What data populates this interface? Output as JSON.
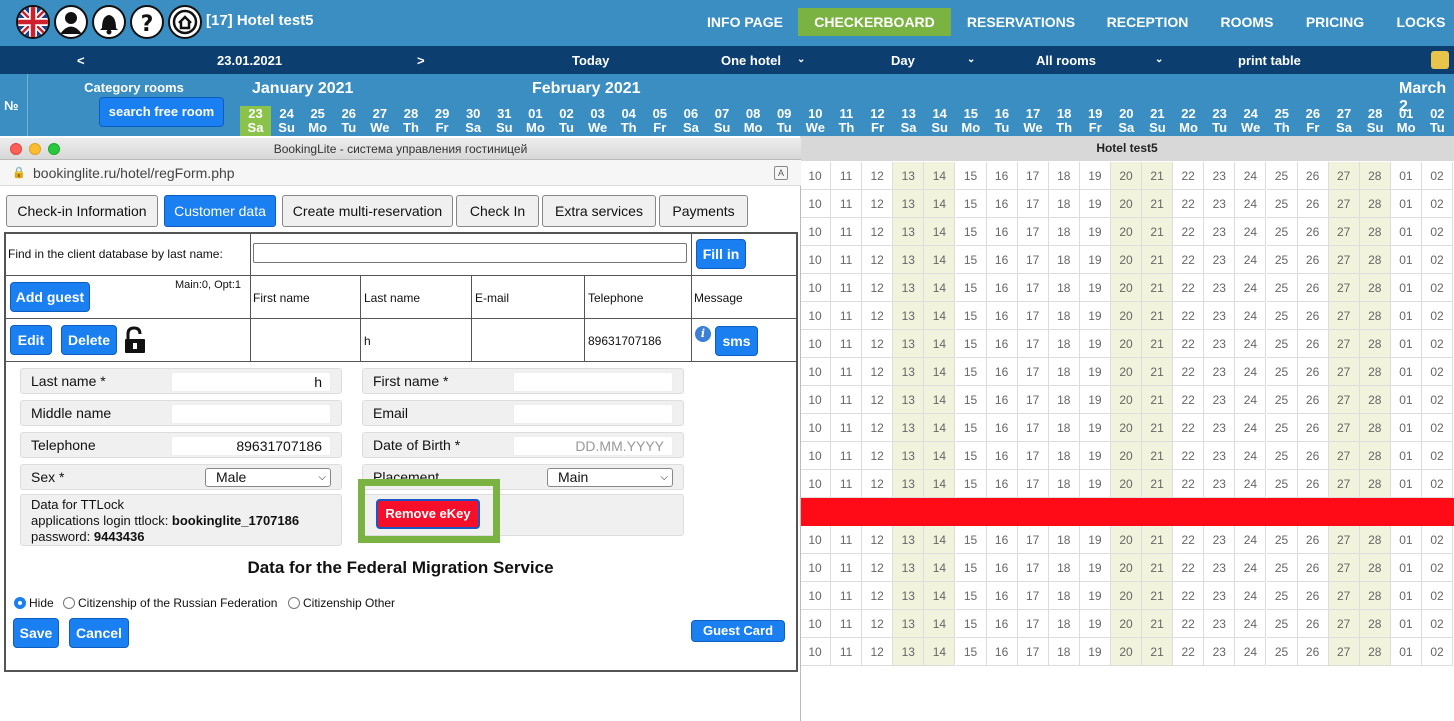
{
  "topbar": {
    "hotel_title": "[17] Hotel test5",
    "nav": [
      "INFO PAGE",
      "CHECKERBOARD",
      "RESERVATIONS",
      "RECEPTION",
      "ROOMS",
      "PRICING",
      "LOCKS"
    ],
    "active_nav": "CHECKERBOARD",
    "icons": [
      "uk-flag-icon",
      "user-icon",
      "bell-icon",
      "help-icon",
      "home-icon"
    ]
  },
  "datebar": {
    "prev": "<",
    "date": "23.01.2021",
    "next": ">",
    "today": "Today",
    "hotel_select": "One hotel",
    "view_select": "Day",
    "rooms_select": "All rooms",
    "print": "print table"
  },
  "calendar": {
    "num_label": "№",
    "category_label": "Category rooms",
    "search_free": "search free room",
    "months": [
      "January 2021",
      "February 2021",
      "March 2"
    ],
    "days": [
      [
        "23",
        "Sa"
      ],
      [
        "24",
        "Su"
      ],
      [
        "25",
        "Mo"
      ],
      [
        "26",
        "Tu"
      ],
      [
        "27",
        "We"
      ],
      [
        "28",
        "Th"
      ],
      [
        "29",
        "Fr"
      ],
      [
        "30",
        "Sa"
      ],
      [
        "31",
        "Su"
      ],
      [
        "01",
        "Mo"
      ],
      [
        "02",
        "Tu"
      ],
      [
        "03",
        "We"
      ],
      [
        "04",
        "Th"
      ],
      [
        "05",
        "Fr"
      ],
      [
        "06",
        "Sa"
      ],
      [
        "07",
        "Su"
      ],
      [
        "08",
        "Mo"
      ],
      [
        "09",
        "Tu"
      ],
      [
        "10",
        "We"
      ],
      [
        "11",
        "Th"
      ],
      [
        "12",
        "Fr"
      ],
      [
        "13",
        "Sa"
      ],
      [
        "14",
        "Su"
      ],
      [
        "15",
        "Mo"
      ],
      [
        "16",
        "Tu"
      ],
      [
        "17",
        "We"
      ],
      [
        "18",
        "Th"
      ],
      [
        "19",
        "Fr"
      ],
      [
        "20",
        "Sa"
      ],
      [
        "21",
        "Su"
      ],
      [
        "22",
        "Mo"
      ],
      [
        "23",
        "Tu"
      ],
      [
        "24",
        "We"
      ],
      [
        "25",
        "Th"
      ],
      [
        "26",
        "Fr"
      ],
      [
        "27",
        "Sa"
      ],
      [
        "28",
        "Su"
      ],
      [
        "01",
        "Mo"
      ],
      [
        "02",
        "Tu"
      ]
    ],
    "hotel_row": "Hotel test5",
    "grid_days": [
      "10",
      "11",
      "12",
      "13",
      "14",
      "15",
      "16",
      "17",
      "18",
      "19",
      "20",
      "21",
      "22",
      "23",
      "24",
      "25",
      "26",
      "27",
      "28",
      "01",
      "02"
    ],
    "weekend_days": [
      "13",
      "14",
      "20",
      "21",
      "27",
      "28"
    ]
  },
  "popup": {
    "window_title": "BookingLite - система управления гостиницей",
    "url": "bookinglite.ru/hotel/regForm.php",
    "tabs": [
      "Check-in Information",
      "Customer data",
      "Create multi-reservation",
      "Check In",
      "Extra services",
      "Payments"
    ],
    "active_tab": "Customer data",
    "find_label": "Find in the client database by last name:",
    "find_value": "",
    "fill_in": "Fill in",
    "add_guest": "Add guest",
    "main_opt": "Main:0, Opt:1",
    "columns": [
      "First name",
      "Last name",
      "E-mail",
      "Telephone",
      "Message"
    ],
    "guest_row": {
      "first_name": "",
      "last_name": "h",
      "email": "",
      "telephone": "89631707186"
    },
    "edit": "Edit",
    "delete": "Delete",
    "sms": "sms",
    "form": {
      "last_name_label": "Last name *",
      "last_name_value": "h",
      "first_name_label": "First name *",
      "first_name_value": "",
      "middle_name_label": "Middle name",
      "middle_name_value": "",
      "email_label": "Email",
      "email_value": "",
      "telephone_label": "Telephone",
      "telephone_value": "89631707186",
      "dob_label": "Date of Birth *",
      "dob_placeholder": "DD.MM.YYYY",
      "sex_label": "Sex *",
      "sex_value": "Male",
      "placement_label": "Placement",
      "placement_value": "Main"
    },
    "ttlock": {
      "line1": "Data for TTLock",
      "login_label": "applications login ttlock: ",
      "login_value": "bookinglite_1707186",
      "password_label": "password: ",
      "password_value": "9443436"
    },
    "remove_ekey": "Remove eKey",
    "fms_title": "Data for the Federal Migration Service",
    "citizenship": [
      "Hide",
      "Citizenship of the Russian Federation",
      "Citizenship Other"
    ],
    "citizenship_selected": "Hide",
    "save": "Save",
    "cancel": "Cancel",
    "guest_card": "Guest Card"
  }
}
